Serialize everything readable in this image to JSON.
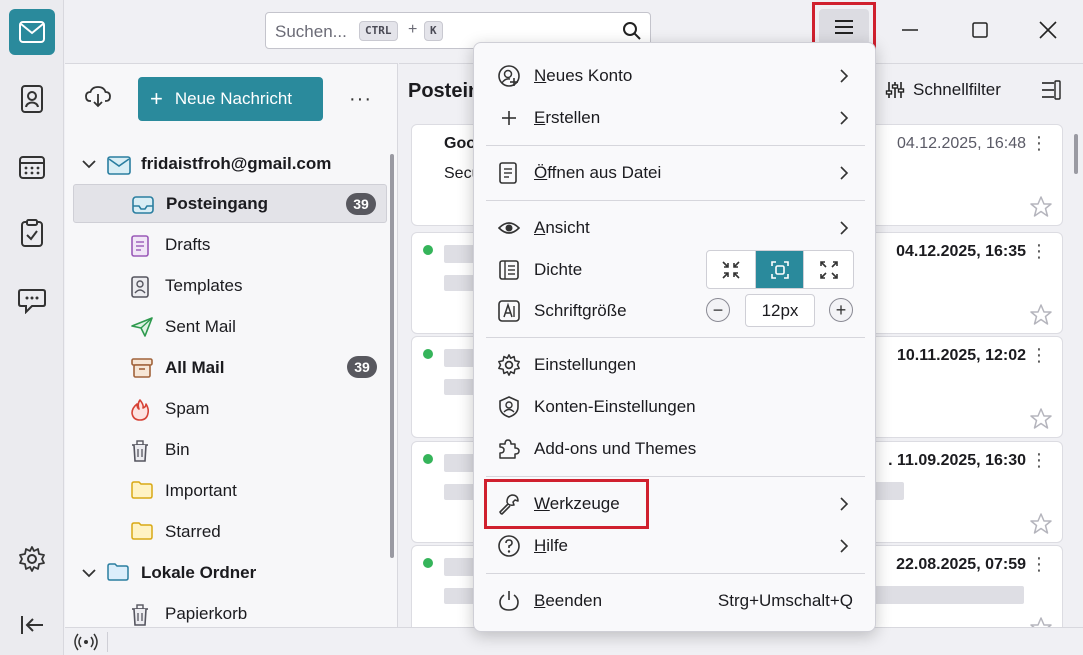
{
  "colors": {
    "accent": "#2a8a9c",
    "highlight": "#d0202e",
    "unread_dot": "#35b45a",
    "badge": "#58585f"
  },
  "spaces": [
    "mail-icon",
    "address-book-icon",
    "calendar-icon",
    "tasks-icon",
    "chat-icon",
    "settings-icon",
    "collapse-icon"
  ],
  "search": {
    "placeholder": "Suchen...",
    "key1": "CTRL",
    "plus": "+",
    "key2": "K"
  },
  "folder_pane": {
    "new_message": "Neue Nachricht",
    "more": "···",
    "account": "fridaistfroh@gmail.com",
    "folders": [
      {
        "label": "Posteingang",
        "count": "39"
      },
      {
        "label": "Drafts"
      },
      {
        "label": "Templates"
      },
      {
        "label": "Sent Mail"
      },
      {
        "label": "All Mail",
        "count": "39"
      },
      {
        "label": "Spam"
      },
      {
        "label": "Bin"
      },
      {
        "label": "Important"
      },
      {
        "label": "Starred"
      }
    ],
    "local": "Lokale Ordner",
    "local_folders": [
      {
        "label": "Papierkorb"
      }
    ]
  },
  "message_list": {
    "title": "Postein",
    "quickfilter": "Schnellfilter",
    "messages": [
      {
        "date": "04.12.2025, 16:48",
        "subject": "Goo",
        "line2": "Secu",
        "unread": false
      },
      {
        "date": "04.12.2025, 16:35",
        "unread": true
      },
      {
        "date": "10.11.2025, 12:02",
        "unread": true
      },
      {
        "date": ". 11.09.2025, 16:30",
        "unread": true
      },
      {
        "date": "22.08.2025, 07:59",
        "unread": true
      }
    ]
  },
  "app_menu": {
    "items": {
      "new_account": {
        "u": "N",
        "rest": "eues Konto"
      },
      "create": {
        "u": "E",
        "rest": "rstellen"
      },
      "open_file": {
        "u": "Ö",
        "rest": "ffnen aus Datei"
      },
      "view": {
        "u": "A",
        "rest": "nsicht"
      },
      "density": "Dichte",
      "font_size": "Schriftgröße",
      "font_size_value": "12px",
      "font_minus": "−",
      "font_plus": "+",
      "settings": "Einstellungen",
      "account_settings": "Konten-Einstellungen",
      "addons": "Add-ons und Themes",
      "tools": {
        "u": "W",
        "rest": "erkzeuge"
      },
      "help": {
        "u": "H",
        "rest": "ilfe"
      },
      "quit": {
        "u": "B",
        "rest": "eenden"
      },
      "quit_shortcut": "Strg+Umschalt+Q"
    }
  }
}
